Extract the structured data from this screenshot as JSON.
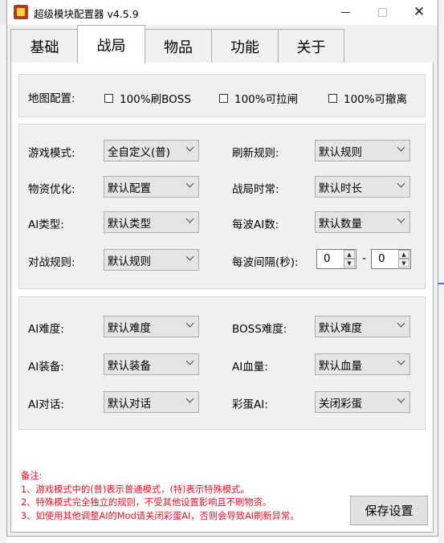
{
  "window": {
    "title": "超级模块配置器 v4.5.9"
  },
  "tabs": [
    {
      "label": "基础",
      "active": false
    },
    {
      "label": "战局",
      "active": true
    },
    {
      "label": "物品",
      "active": false
    },
    {
      "label": "功能",
      "active": false
    },
    {
      "label": "关于",
      "active": false
    }
  ],
  "map_config": {
    "label": "地图配置:",
    "checkboxes": [
      {
        "label": "100%刷BOSS",
        "checked": false
      },
      {
        "label": "100%可拉闸",
        "checked": false
      },
      {
        "label": "100%可撤离",
        "checked": false
      }
    ]
  },
  "game_settings": {
    "game_mode": {
      "label": "游戏模式:",
      "value": "全自定义(普)"
    },
    "refresh_rule": {
      "label": "刷新规则:",
      "value": "默认规则"
    },
    "supply_opt": {
      "label": "物资优化:",
      "value": "默认配置"
    },
    "match_duration": {
      "label": "战局时常:",
      "value": "默认时长"
    },
    "ai_type": {
      "label": "AI类型:",
      "value": "默认类型"
    },
    "ai_per_wave": {
      "label": "每波AI数:",
      "value": "默认数量"
    },
    "combat_rule": {
      "label": "对战规则:",
      "value": "默认规则"
    },
    "wave_interval": {
      "label": "每波间隔(秒):",
      "min": "0",
      "separator": "-",
      "max": "0"
    }
  },
  "ai_settings": {
    "ai_difficulty": {
      "label": "AI难度:",
      "value": "默认难度"
    },
    "boss_difficulty": {
      "label": "BOSS难度:",
      "value": "默认难度"
    },
    "ai_gear": {
      "label": "AI装备:",
      "value": "默认装备"
    },
    "ai_health": {
      "label": "AI血量:",
      "value": "默认血量"
    },
    "ai_dialog": {
      "label": "AI对话:",
      "value": "默认对话"
    },
    "easter_egg": {
      "label": "彩蛋AI:",
      "value": "关闭彩蛋"
    }
  },
  "notes": {
    "title": "备注:",
    "lines": [
      "1、游戏模式中的(普)表示普通模式，(特)表示特殊模式。",
      "2、特殊模式完全独立的规则，不受其他设置影响且不刷物资。",
      "3、如使用其他调整AI的Mod请关闭彩蛋AI，否则会导致AI刷新异常。"
    ]
  },
  "save_button": {
    "label": "保存设置"
  },
  "colors": {
    "note_text": "#e81123",
    "accent": "#3a7bd5"
  }
}
